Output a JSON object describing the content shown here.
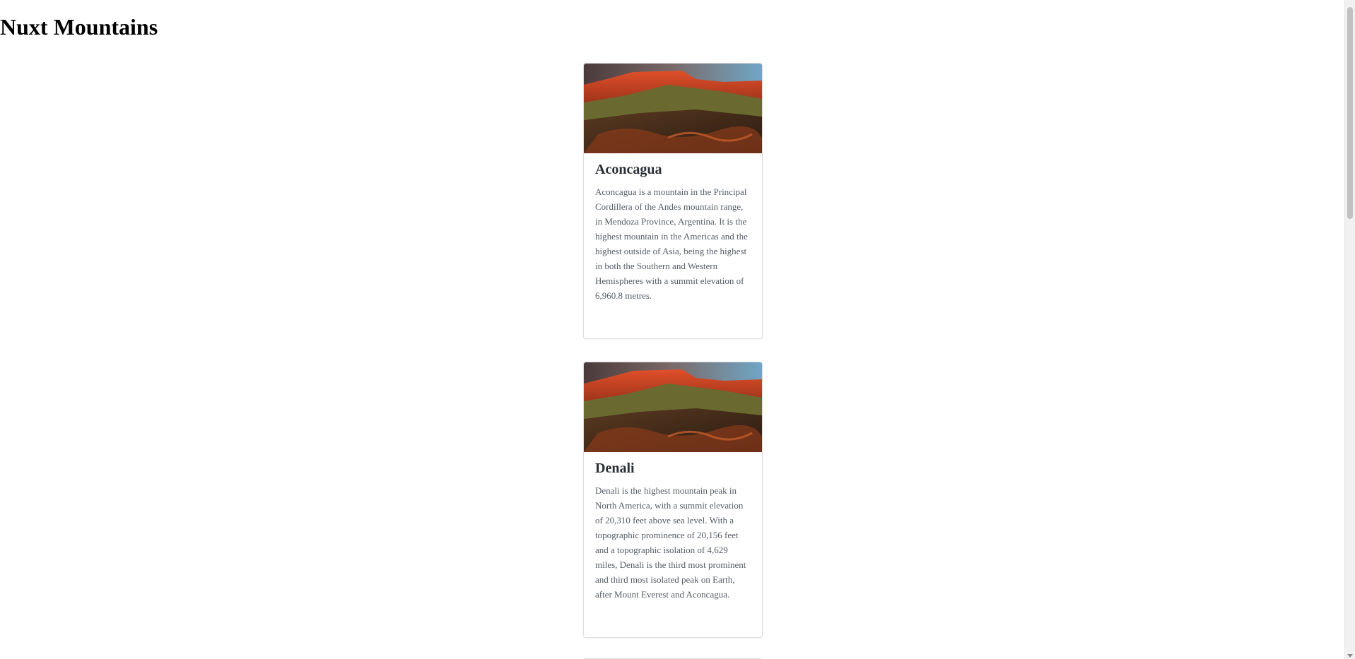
{
  "page": {
    "title": "Nuxt Mountains"
  },
  "mountains": [
    {
      "title": "Aconcagua",
      "description": "Aconcagua is a mountain in the Principal Cordillera of the Andes mountain range, in Mendoza Province, Argentina. It is the highest mountain in the Americas and the highest outside of Asia, being the highest in both the Southern and Western Hemispheres with a summit elevation of 6,960.8 metres.",
      "image": "mountain-photo"
    },
    {
      "title": "Denali",
      "description": "Denali is the highest mountain peak in North America, with a summit elevation of 20,310 feet above sea level. With a topographic prominence of 20,156 feet and a topographic isolation of 4,629 miles, Denali is the third most prominent and third most isolated peak on Earth, after Mount Everest and Aconcagua.",
      "image": "mountain-photo"
    }
  ],
  "colors": {
    "title": "#2b3036",
    "text": "#555c66",
    "card_border": "#dcdcdc"
  }
}
